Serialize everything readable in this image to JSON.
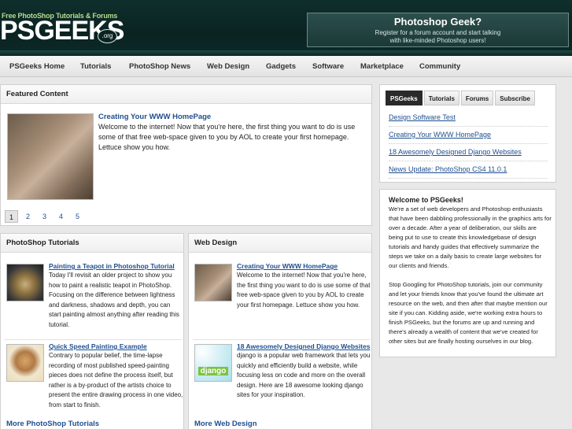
{
  "header": {
    "logo_tagline": "Free PhotoShop Tutorials & Forums",
    "logo_text": "PSGEEKS",
    "logo_suffix": ".org",
    "promo_title": "Photoshop Geek?",
    "promo_line1": "Register for a forum account and start talking",
    "promo_line2": "with like-minded Photoshop users!"
  },
  "nav": {
    "items": [
      "PSGeeks Home",
      "Tutorials",
      "PhotoShop News",
      "Web Design",
      "Gadgets",
      "Software",
      "Marketplace",
      "Community"
    ]
  },
  "featured": {
    "heading": "Featured Content",
    "title": "Creating Your WWW HomePage",
    "body": "Welcome to the internet! Now that you're here, the first thing you want to do is use some of that free web-space given to you by AOL to create your first homepage. Lettuce show you how.",
    "pages": [
      "1",
      "2",
      "3",
      "4",
      "5"
    ],
    "active_page": "1"
  },
  "photoshop": {
    "heading": "PhotoShop Tutorials",
    "articles": [
      {
        "title": "Painting a Teapot in Photoshop Tutorial",
        "body": "Today I'll revisit an older project to show you how to paint a realistic teapot in PhotoShop. Focusing on the difference between lightness and darkness, shadows and depth, you can start painting almost anything after reading this tutorial."
      },
      {
        "title": "Quick Speed Painting Example",
        "body": "Contrary to popular belief, the time-lapse recording of most published speed-painting pieces does not define the process itself, but rather is a by-product of the artists choice to present the entire drawing process in one video, from start to finish."
      }
    ],
    "more": "More PhotoShop Tutorials"
  },
  "webdesign": {
    "heading": "Web Design",
    "articles": [
      {
        "title": "Creating Your WWW HomePage",
        "body": "Welcome to the internet! Now that you're here, the first thing you want to do is use some of that free web-space given to you by AOL to create your first homepage. Lettuce show you how."
      },
      {
        "title": "18 Awesomely Designed Django Websites",
        "body": "django is a popular web framework that lets you quickly and efficiently build a website, while focusing less on code and more on the overall design. Here are 18 awesome looking django sites for your inspiration.",
        "thumb_text": "django"
      }
    ],
    "more": "More Web Design"
  },
  "sidebar": {
    "tabs": [
      "PSGeeks",
      "Tutorials",
      "Forums",
      "Subscribe"
    ],
    "links": [
      "Design Software Test",
      "Creating Your WWW HomePage",
      "18 Awesomely Designed Django Websites",
      "News Update: PhotoShop CS4 11.0.1"
    ],
    "welcome_title": "Welcome to PSGeeks!",
    "welcome_p1": "We're a set of web developers and Photoshop enthusiasts that have been dabbling professionally in the graphics arts for over a decade. After a year of deliberation, our skills are being put to use to create this knowledgebase of design tutorials and handy guides that effectively summarize the steps we take on a daily basis to create large websites for our clients and friends.",
    "welcome_p2": "Stop Googling for PhotoShop tutorials, join our community and let your friends know that you've found the ultimate art resource on the web, and then after that maybe mention our site if you can. Kidding aside, we're working extra hours to finish PSGeeks, but the forums are up and running and there's already a wealth of content that we've created for other sites but are finally hosting ourselves in our blog."
  }
}
